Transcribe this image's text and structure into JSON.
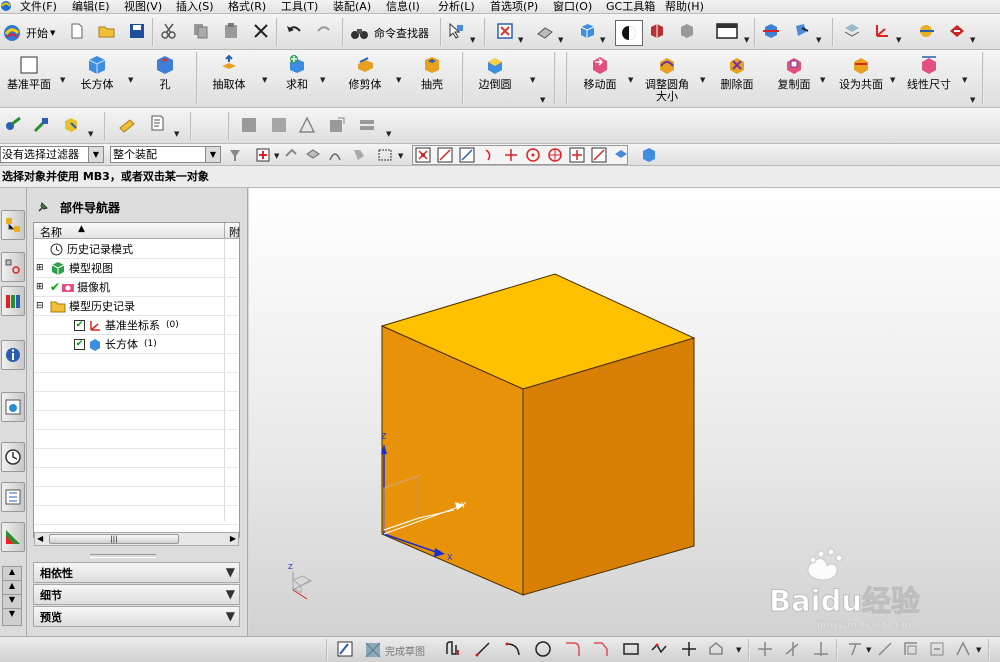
{
  "menu": [
    "文件(F)",
    "编辑(E)",
    "视图(V)",
    "插入(S)",
    "格式(R)",
    "工具(T)",
    "装配(A)",
    "信息(I)",
    "分析(L)",
    "首选项(P)",
    "窗口(O)",
    "GC工具箱",
    "帮助(H)"
  ],
  "toolbar1": {
    "start_label": "开始",
    "command_finder_label": "命令查找器"
  },
  "features": [
    {
      "label": "基准平面"
    },
    {
      "label": "长方体"
    },
    {
      "label": "孔"
    },
    {
      "label": "抽取体"
    },
    {
      "label": "求和"
    },
    {
      "label": "修剪体"
    },
    {
      "label": "抽壳"
    },
    {
      "label": "边倒圆"
    },
    {
      "label": "移动面"
    },
    {
      "label": "调整圆角大小"
    },
    {
      "label": "删除面"
    },
    {
      "label": "复制面"
    },
    {
      "label": "设为共面"
    },
    {
      "label": "线性尺寸"
    }
  ],
  "selection": {
    "filter_value": "没有选择过滤器",
    "scope_value": "整个装配"
  },
  "status_prompt": "选择对象并使用 MB3，或者双击某一对象",
  "navigator": {
    "title": "部件导航器",
    "column_name": "名称",
    "column_extra": "附",
    "items": [
      {
        "label": "历史记录模式"
      },
      {
        "label": "模型视图"
      },
      {
        "label": "摄像机"
      },
      {
        "label": "模型历史记录"
      },
      {
        "label": "基准坐标系",
        "count": "(0)"
      },
      {
        "label": "长方体",
        "count": "(1)"
      }
    ],
    "panels": [
      "相依性",
      "细节",
      "预览"
    ]
  },
  "bottom": {
    "finish_sketch_label": "完成草图"
  },
  "watermark": {
    "brand": "Baidu经验",
    "url": "jingyan.baidu.com"
  },
  "triad_labels": {
    "z": "Z",
    "y": "Y",
    "x": "X"
  },
  "colors": {
    "cube_top": "#FFC000",
    "cube_front": "#E8920A",
    "cube_side": "#D87F05",
    "accent": "#1a5fb4"
  }
}
